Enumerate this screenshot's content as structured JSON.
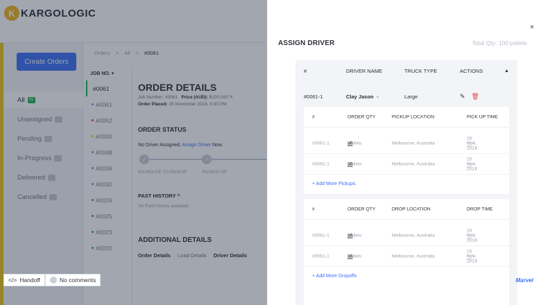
{
  "app": {
    "logo_text": "KARGOLOGIC",
    "create_button": "Create Orders",
    "sidebar": [
      {
        "label": "All",
        "count": "41",
        "active": true
      },
      {
        "label": "Unassigned",
        "count": "",
        "active": false
      },
      {
        "label": "Pending",
        "count": "",
        "active": false
      },
      {
        "label": "In-Progress",
        "count": "",
        "active": false
      },
      {
        "label": "Delivered",
        "count": "",
        "active": false
      },
      {
        "label": "Cancelled",
        "count": "",
        "active": false
      }
    ],
    "breadcrumb": {
      "orders": "Orders",
      "all": "All",
      "current": "#0061",
      "sep": ">"
    },
    "job_header": "JOB NO.",
    "jobs": [
      "#0061",
      "#0061",
      "#0052",
      "#0050",
      "#0048",
      "#0036",
      "#0030",
      "#0026",
      "#0025",
      "#0023",
      "#0020"
    ],
    "order_details": {
      "title": "ORDER DETAILS",
      "job_label": "Job Number:",
      "job_value": "#0061",
      "price_label": "Price (AUD):",
      "price_value": "$100,000",
      "placed_label": "Order Placed:",
      "placed_value": "28 November 2018, 5:30 PM"
    },
    "order_status": {
      "title": "ORDER STATUS",
      "message_prefix": "No Driver Assigned,",
      "message_link": "Assign Driver",
      "message_suffix": "Now.",
      "step1": "EN-ROUTE TO PICKUP",
      "step2": "PICKED UP",
      "dash": "-"
    },
    "past_history": {
      "title": "PAST HISTORY",
      "empty": "No Past History available."
    },
    "additional": {
      "title": "ADDITIONAL DETAILS",
      "tabs": [
        "Order Details",
        "Load Details",
        "Driver Details"
      ]
    },
    "footer": {
      "handoff": "Handoff",
      "comments": "No comments"
    }
  },
  "drawer": {
    "title": "ASSIGN DRIVER",
    "total_qty": "Total Qty: 100 pallets",
    "headers": {
      "num": "#",
      "driver": "DRIVER NAME",
      "truck": "TRUCK TYPE",
      "actions": "ACTIONS"
    },
    "assignment": {
      "num": "#0061-1",
      "driver": "Clay Jason",
      "truck": "Large"
    },
    "pickups": {
      "headers": {
        "num": "#",
        "qty": "ORDER QTY",
        "loc": "PICKUP LOCATION",
        "time": "PICK UP TIME"
      },
      "rows": [
        {
          "num": "#0061-1",
          "qty": "50",
          "unit": "Pallets",
          "loc": "Melbourne, Australia",
          "date": "15 Nov, 2018",
          "time": "08:30 AM"
        },
        {
          "num": "#0061-1",
          "qty": "50",
          "unit": "Pallets",
          "loc": "Melbourne, Australia",
          "date": "15 Nov, 2018",
          "time": "08:30 AM"
        }
      ],
      "add": "+ Add More Pickups"
    },
    "dropoffs": {
      "headers": {
        "num": "#",
        "qty": "ORDER QTY",
        "loc": "DROP LOCATION",
        "time": "DROP TIME"
      },
      "rows": [
        {
          "num": "#0061-1",
          "qty": "50",
          "unit": "Pallets",
          "loc": "Melbourne, Australia",
          "date": "15 Nov, 2018",
          "time": "08:30 AM"
        },
        {
          "num": "#0061-1",
          "qty": "50",
          "unit": "Pallets",
          "loc": "Melbourne, Australia",
          "date": "15 Nov, 2018",
          "time": "08:30 AM"
        }
      ],
      "add": "+ Add More Dropoffs"
    },
    "close": "×",
    "brand": "Marvel"
  }
}
